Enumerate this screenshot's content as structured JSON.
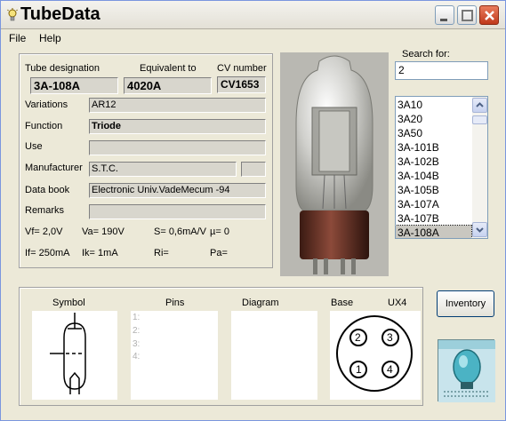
{
  "window": {
    "title": "TubeData"
  },
  "menu": {
    "file": "File",
    "help": "Help"
  },
  "details": {
    "tube_designation_label": "Tube designation",
    "equivalent_to_label": "Equivalent to",
    "cv_number_label": "CV number",
    "tube_designation": "3A-108A",
    "equivalent_to": "4020A",
    "cv_number": "CV1653",
    "variations_label": "Variations",
    "variations": "AR12",
    "function_label": "Function",
    "function": "Triode",
    "use_label": "Use",
    "use": "",
    "manufacturer_label": "Manufacturer",
    "manufacturer": "S.T.C.",
    "manufacturer_extra": "",
    "data_book_label": "Data book",
    "data_book": "Electronic Univ.VadeMecum -94",
    "remarks_label": "Remarks",
    "remarks": ""
  },
  "params": {
    "vf": "Vf= 2,0V",
    "va": "Va= 190V",
    "s": "S= 0,6mA/V",
    "mu": "µ=    0",
    "if": "If= 250mA",
    "ik": "Ik=  1mA",
    "ri": "Ri=",
    "pa": "Pa="
  },
  "search": {
    "label": "Search for:",
    "value": "2"
  },
  "tube_list": {
    "items": [
      "3A10",
      "3A20",
      "3A50",
      "3A-101B",
      "3A-102B",
      "3A-104B",
      "3A-105B",
      "3A-107A",
      "3A-107B",
      "3A-108A"
    ],
    "selected": "3A-108A"
  },
  "lower": {
    "symbol_label": "Symbol",
    "pins_label": "Pins",
    "diagram_label": "Diagram",
    "base_label": "Base",
    "base_type": "UX4",
    "pin_numbers": [
      "1:",
      "2:",
      "3:",
      "4:"
    ],
    "base_pins": [
      "2",
      "3",
      "1",
      "4"
    ]
  },
  "inventory_button": "Inventory",
  "icons": {
    "app": "lightbulb-icon",
    "minimize": "minimize-icon",
    "maximize": "maximize-icon",
    "close": "close-icon",
    "scroll_up": "chevron-up-icon",
    "scroll_down": "chevron-down-icon"
  }
}
